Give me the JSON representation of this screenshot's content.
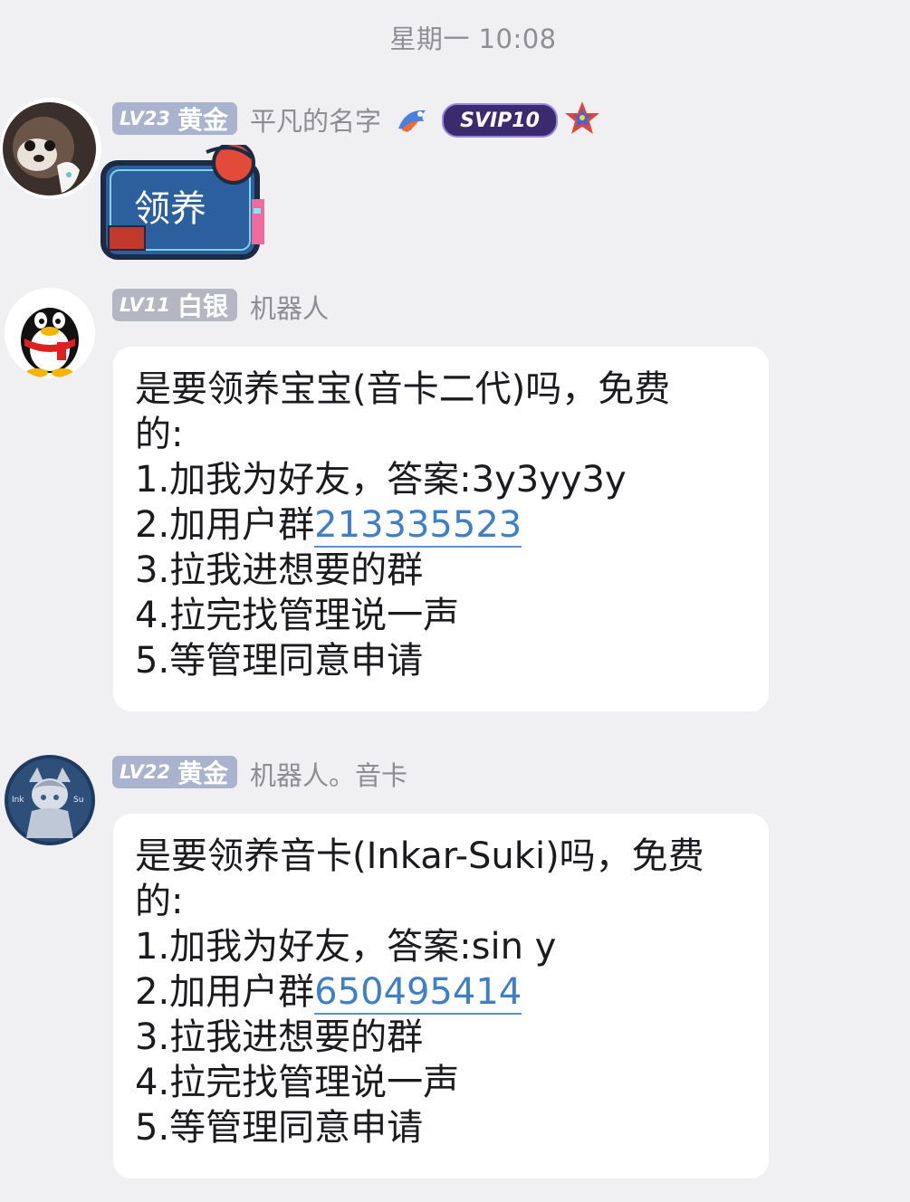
{
  "timestamp": "星期一 10:08",
  "messages": [
    {
      "level": "LV23",
      "rank": "黄金",
      "nickname": "平凡的名字",
      "vip_badge": "SVIP10",
      "sticker_text": "领养",
      "avatar_icon": "cat-avatar-icon"
    },
    {
      "level": "LV11",
      "rank": "白银",
      "nickname": "机器人",
      "avatar_icon": "qq-penguin-avatar-icon",
      "lines": {
        "l1": "是要领养宝宝(音卡二代)吗，免费",
        "l2": "的:",
        "l3": "1.加我为好友，答案:3y3yy3y",
        "l4_prefix": "2.加用户群",
        "l4_link": "213335523",
        "l5": "3.拉我进想要的群",
        "l6": "4.拉完找管理说一声",
        "l7": "5.等管理同意申请"
      }
    },
    {
      "level": "LV22",
      "rank": "黄金",
      "nickname": "机器人。音卡",
      "avatar_icon": "anime-character-avatar-icon",
      "lines": {
        "l1": "是要领养音卡(Inkar-Suki)吗，免费",
        "l2": "的:",
        "l3": "1.加我为好友，答案:sin y",
        "l4_prefix": "2.加用户群",
        "l4_link": "650495414",
        "l5": "3.拉我进想要的群",
        "l6": "4.拉完找管理说一声",
        "l7": "5.等管理同意申请"
      }
    }
  ],
  "colors": {
    "background": "#f0f0f3",
    "bubble": "#ffffff",
    "link": "#3f7fc7",
    "badge_gold": "#a9b3ce",
    "badge_silver": "#b4b7c2"
  }
}
